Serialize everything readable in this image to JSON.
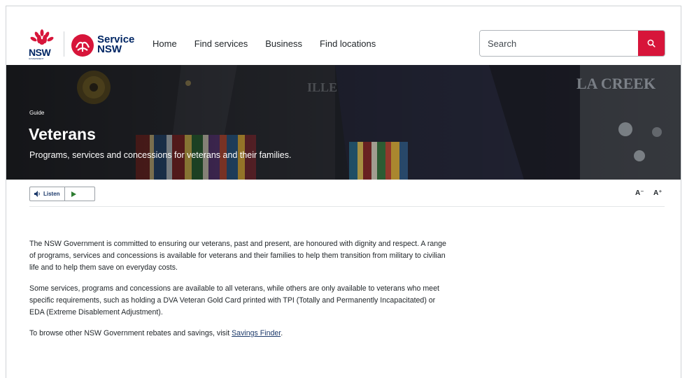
{
  "header": {
    "nsw_logo_text": "NSW",
    "nsw_logo_subtext": "GOVERNMENT",
    "service_logo_line1": "Service",
    "service_logo_line2": "NSW",
    "nav": [
      {
        "label": "Home"
      },
      {
        "label": "Find services"
      },
      {
        "label": "Business"
      },
      {
        "label": "Find locations"
      }
    ],
    "search": {
      "placeholder": "Search",
      "value": ""
    },
    "icons": {
      "search_button": "search-icon"
    }
  },
  "hero": {
    "label": "Guide",
    "title": "Veterans",
    "subtitle": "Programs, services and concessions for veterans and their families."
  },
  "toolbar": {
    "listen_label": "Listen",
    "listen_icon": "speaker-icon",
    "play_icon": "play-icon",
    "font_decrease": "A⁻",
    "font_increase": "A⁺"
  },
  "content": {
    "para1": "The NSW Government is committed to ensuring our veterans, past and present, are honoured with dignity and respect. A range of programs, services and concessions is available for veterans and their families to help them transition from military to civilian life and to help them save on everyday costs.",
    "para2": "Some services, programs and concessions are available to all veterans, while others are only available to veterans who meet specific requirements, such as holding a DVA Veteran Gold Card printed with TPI (Totally and Permanently Incapacitated) or EDA (Extreme Disablement Adjustment).",
    "para3_prefix": "To browse other NSW Government rebates and savings, visit ",
    "para3_link": "Savings Finder",
    "para3_suffix": "."
  },
  "colors": {
    "brand_red": "#d7153a",
    "brand_navy": "#002664",
    "link": "#1d3a6b"
  }
}
